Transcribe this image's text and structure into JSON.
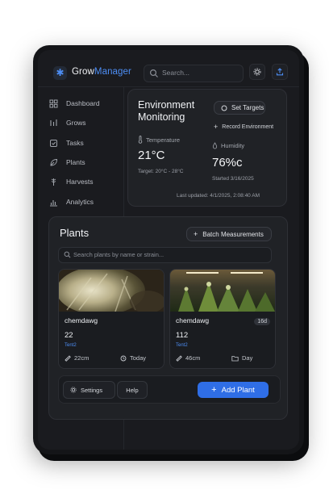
{
  "app": {
    "title_part1": "Grow",
    "title_part2": "Manager",
    "logo_icon": "asterisk-icon"
  },
  "search": {
    "placeholder": "Search..."
  },
  "sidebar": {
    "items": [
      {
        "label": "Dashboard",
        "icon": "dashboard-icon"
      },
      {
        "label": "Grows",
        "icon": "grows-icon"
      },
      {
        "label": "Tasks",
        "icon": "tasks-icon"
      },
      {
        "label": "Plants",
        "icon": "leaf-icon"
      },
      {
        "label": "Harvests",
        "icon": "harvest-icon"
      },
      {
        "label": "Analytics",
        "icon": "analytics-icon"
      }
    ]
  },
  "environment": {
    "title_line1": "Environment",
    "title_line2": "Monitoring",
    "set_targets_label": "Set Targets",
    "record_label": "Record Environment",
    "temperature": {
      "label": "Temperature",
      "value": "21°C",
      "note": "Target: 20°C - 28°C"
    },
    "humidity": {
      "label": "Humidity",
      "value": "76%c",
      "note": "Started 3/16/2025"
    },
    "last_updated": "Last updated: 4/1/2025, 2:08:40 AM"
  },
  "plants": {
    "title": "Plants",
    "batch_label": "Batch Measurements",
    "search_placeholder": "Search plants by name or strain...",
    "cards": [
      {
        "name": "chemdawg",
        "number": "22",
        "tent": "Tent2",
        "height": "22cm",
        "date": "Today"
      },
      {
        "name": "chemdawg",
        "number": "112",
        "tent": "Tent2",
        "height": "46cm",
        "date": "Day",
        "badge": "16d"
      }
    ]
  },
  "footer": {
    "settings_label": "Settings",
    "help_label": "Help",
    "add_plant_label": "Add Plant"
  },
  "colors": {
    "accent": "#2f6ee6",
    "background": "#1a1b1f",
    "card": "#202226",
    "link": "#4d8ef5"
  }
}
